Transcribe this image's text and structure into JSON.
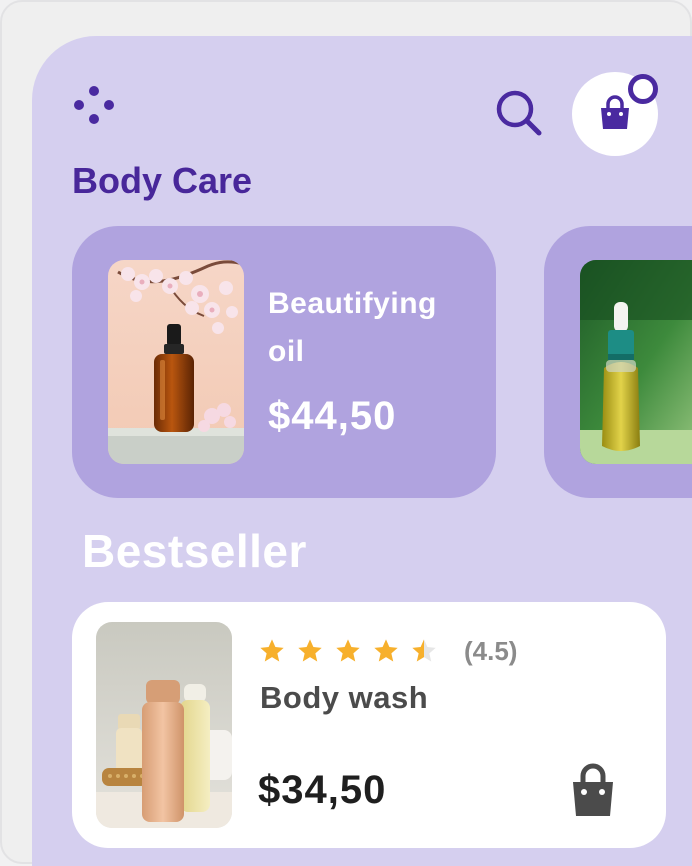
{
  "header": {
    "menu_icon": "dots-menu-icon",
    "search_icon": "search-icon",
    "bag_icon": "shopping-bag-icon"
  },
  "category": {
    "title": "Body Care"
  },
  "promo_cards": [
    {
      "name": "Beautifying oil",
      "price": "$44,50",
      "image": "amber-dropper-bottle-with-blossoms"
    },
    {
      "name": "",
      "price": "",
      "image": "green-dropper-bottle"
    }
  ],
  "bestseller": {
    "title": "Bestseller",
    "item": {
      "rating_value": 4.5,
      "rating_text": "(4.5)",
      "name": "Body wash",
      "price": "$34,50",
      "image": "body-wash-bottles",
      "cart_icon": "shopping-bag-icon"
    }
  },
  "colors": {
    "background": "#d5cfef",
    "card": "#b0a3df",
    "accent": "#48279a",
    "star": "#f7b02c"
  }
}
